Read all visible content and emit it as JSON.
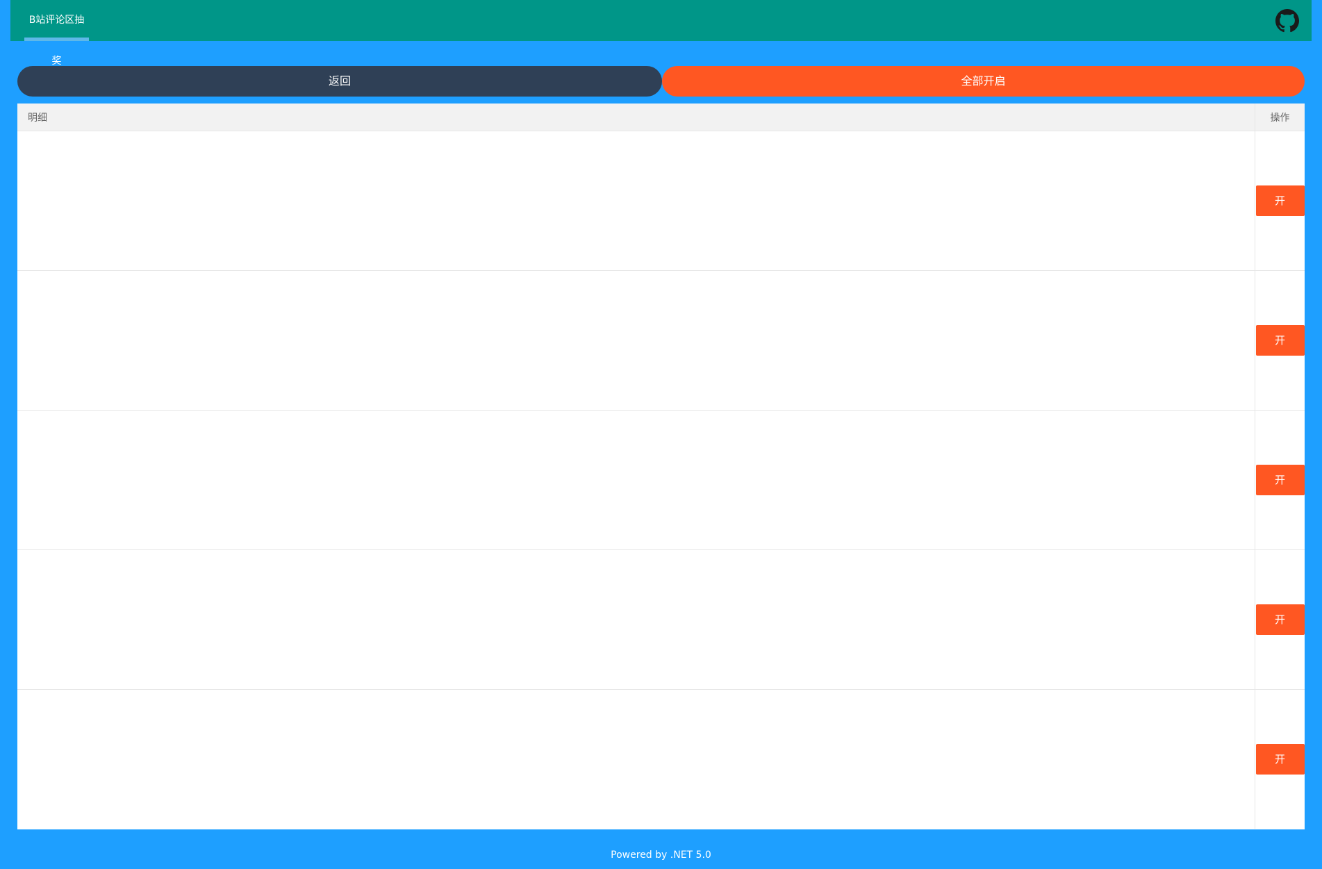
{
  "header": {
    "tab_label": "B站评论区抽奖",
    "github_icon": "github-icon"
  },
  "actions": {
    "back_label": "返回",
    "open_all_label": "全部开启"
  },
  "table": {
    "columns": [
      "明细",
      "操作"
    ],
    "rows": [
      {
        "detail": "",
        "action_label": "开"
      },
      {
        "detail": "",
        "action_label": "开"
      },
      {
        "detail": "",
        "action_label": "开"
      },
      {
        "detail": "",
        "action_label": "开"
      },
      {
        "detail": "",
        "action_label": "开"
      }
    ]
  },
  "footer": {
    "text": "Powered by .NET 5.0"
  },
  "colors": {
    "page_bg": "#1E9FFF",
    "header_bg": "#009688",
    "back_button": "#2F4056",
    "accent": "#FF5722"
  }
}
